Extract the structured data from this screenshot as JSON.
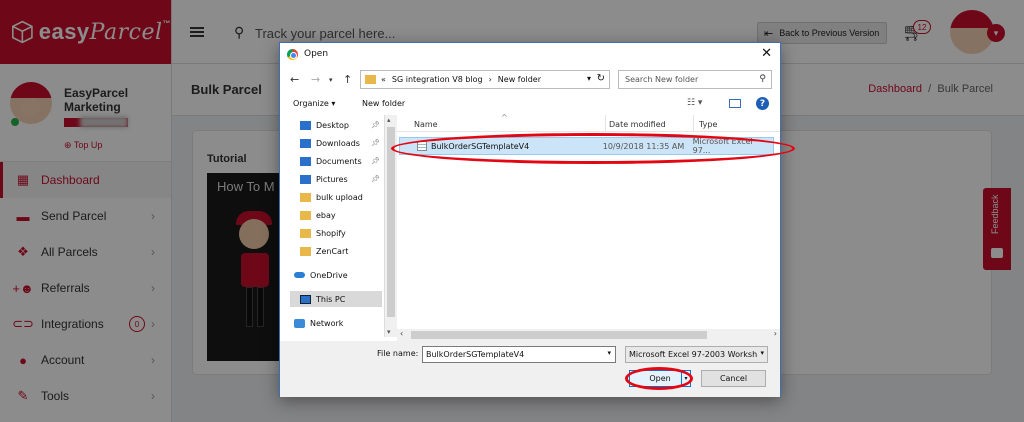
{
  "app": {
    "brand_main": "easy",
    "brand_script": "Parcel",
    "brand_tm": "™",
    "search_placeholder": "Track your parcel here...",
    "back_label": "Back to Previous Version",
    "cart_count": "12",
    "accent": "#c8102e"
  },
  "profile": {
    "name": "EasyParcel Marketing",
    "topup_label": "Top Up"
  },
  "sidebar": {
    "items": [
      {
        "label": "Dashboard",
        "icon": "dashboard-icon"
      },
      {
        "label": "Send Parcel",
        "icon": "truck-icon"
      },
      {
        "label": "All Parcels",
        "icon": "boxes-icon"
      },
      {
        "label": "Referrals",
        "icon": "add-user-icon"
      },
      {
        "label": "Integrations",
        "icon": "link-icon",
        "badge": "0"
      },
      {
        "label": "Account",
        "icon": "person-icon"
      },
      {
        "label": "Tools",
        "icon": "wrench-icon"
      }
    ]
  },
  "page": {
    "title": "Bulk Parcel",
    "breadcrumb_link": "Dashboard",
    "breadcrumb_sep": "/",
    "breadcrumb_current": "Bulk Parcel",
    "tutorial_label": "Tutorial",
    "video_title": "How To M",
    "feedback_label": "Feedback"
  },
  "dialog": {
    "title": "Open",
    "path_segments": [
      "«",
      "SG integration V8 blog",
      "›",
      "New folder"
    ],
    "search_placeholder": "Search New folder",
    "organize_label": "Organize ▾",
    "new_folder_label": "New folder",
    "nav_items": [
      {
        "label": "Desktop",
        "pinned": true
      },
      {
        "label": "Downloads",
        "pinned": true
      },
      {
        "label": "Documents",
        "pinned": true
      },
      {
        "label": "Pictures",
        "pinned": true
      },
      {
        "label": "bulk upload"
      },
      {
        "label": "ebay"
      },
      {
        "label": "Shopify"
      },
      {
        "label": "ZenCart"
      },
      {
        "label": "OneDrive"
      },
      {
        "label": "This PC",
        "selected": true
      },
      {
        "label": "Network"
      }
    ],
    "columns": [
      "Name",
      "Date modified",
      "Type"
    ],
    "files": [
      {
        "name": "BulkOrderSGTemplateV4",
        "date": "10/9/2018 11:35 AM",
        "type": "Microsoft Excel 97..."
      }
    ],
    "filename_label": "File name:",
    "filename_value": "BulkOrderSGTemplateV4",
    "filetype_value": "Microsoft Excel 97-2003 Worksh",
    "open_label": "Open",
    "cancel_label": "Cancel",
    "highlight_color": "#e30613"
  }
}
